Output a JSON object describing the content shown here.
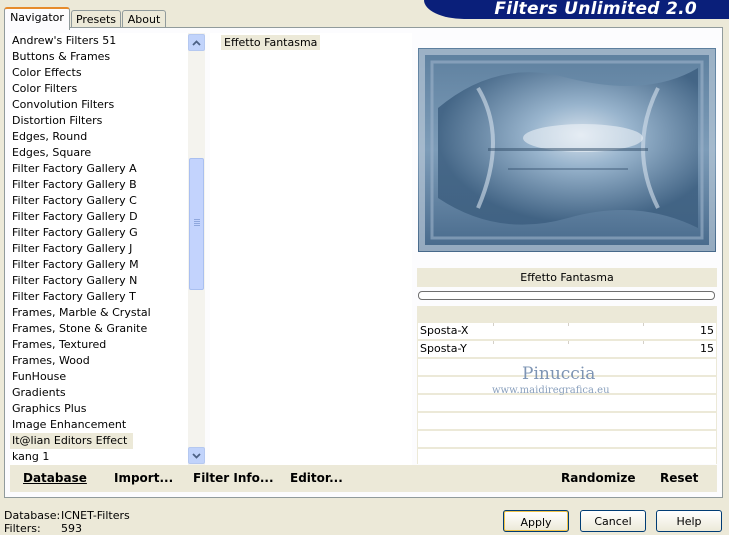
{
  "app": {
    "title": "Filters Unlimited 2.0"
  },
  "tabs": [
    {
      "label": "Navigator",
      "active": true
    },
    {
      "label": "Presets",
      "active": false
    },
    {
      "label": "About",
      "active": false
    }
  ],
  "categories": {
    "items": [
      "Andrew's Filters 51",
      "Buttons & Frames",
      "Color Effects",
      "Color Filters",
      "Convolution Filters",
      "Distortion Filters",
      "Edges, Round",
      "Edges, Square",
      "Filter Factory Gallery A",
      "Filter Factory Gallery B",
      "Filter Factory Gallery C",
      "Filter Factory Gallery D",
      "Filter Factory Gallery G",
      "Filter Factory Gallery J",
      "Filter Factory Gallery M",
      "Filter Factory Gallery N",
      "Filter Factory Gallery T",
      "Frames, Marble & Crystal",
      "Frames, Stone & Granite",
      "Frames, Textured",
      "Frames, Wood",
      "FunHouse",
      "Gradients",
      "Graphics Plus",
      "Image Enhancement",
      "It@lian Editors Effect",
      "kang 1"
    ],
    "selected": "It@lian Editors Effect"
  },
  "filters": {
    "items": [
      "Effetto Fantasma"
    ],
    "selected": "Effetto Fantasma"
  },
  "preview": {
    "filter_name": "Effetto Fantasma",
    "colors": {
      "light": "#dfe9f2",
      "mid": "#7fa0bd",
      "dark": "#3b5a7a",
      "frame": "#b7c6d6"
    }
  },
  "params": [
    {
      "label": "Sposta-X",
      "value": "15"
    },
    {
      "label": "Sposta-Y",
      "value": "15"
    }
  ],
  "toolbar": {
    "database": "Database",
    "import": "Import...",
    "filter_info": "Filter Info...",
    "editor": "Editor...",
    "randomize": "Randomize",
    "reset": "Reset"
  },
  "status": {
    "database_label": "Database:",
    "database_value": "ICNET-Filters",
    "filters_label": "Filters:",
    "filters_value": "593"
  },
  "buttons": {
    "apply": "Apply",
    "cancel": "Cancel",
    "help": "Help"
  },
  "watermark": {
    "name": "Pinuccia",
    "url": "www.maidiregrafica.eu"
  }
}
